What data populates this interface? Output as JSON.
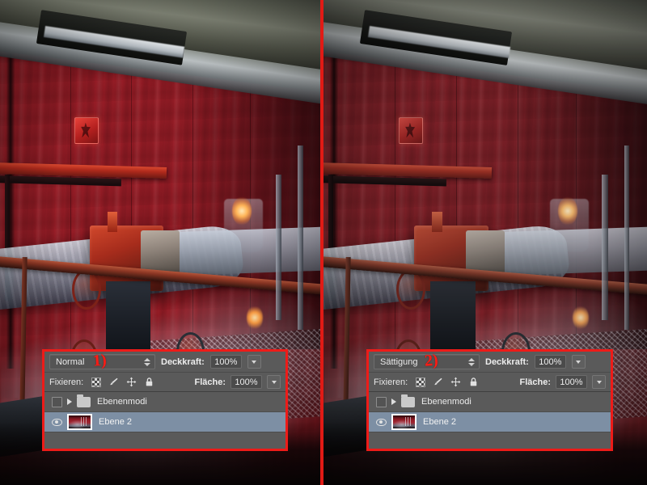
{
  "comparison": {
    "divider_color": "#e11a15",
    "annotation_color": "#ff1b14"
  },
  "panels": [
    {
      "id": "left",
      "callout": "1)",
      "blend_mode_select": {
        "value": "Normal",
        "icon": "updown-arrows-icon"
      },
      "opacity": {
        "label": "Deckkraft:",
        "value": "100%",
        "stepper_icon": "chevron-down-icon"
      },
      "lock": {
        "label": "Fixieren:",
        "icons": [
          "transparent-pixels-checkerboard-icon",
          "paintbrush-icon",
          "move-arrows-icon",
          "lock-all-icon"
        ]
      },
      "fill": {
        "label": "Fläche:",
        "value": "100%",
        "stepper_icon": "chevron-down-icon"
      },
      "layers": [
        {
          "type": "group",
          "name": "Ebenenmodi",
          "visible": false,
          "selected": false,
          "disclosure_icon": "disclosure-triangle-collapsed-icon",
          "folder_icon": "folder-icon",
          "visibility_icon": "eye-off-icon"
        },
        {
          "type": "layer",
          "name": "Ebene 2",
          "visible": true,
          "selected": true,
          "thumbnail_icon": "layer-thumbnail",
          "visibility_icon": "eye-icon"
        }
      ]
    },
    {
      "id": "right",
      "callout": "2)",
      "blend_mode_select": {
        "value": "Sättigung",
        "icon": "updown-arrows-icon"
      },
      "opacity": {
        "label": "Deckkraft:",
        "value": "100%",
        "stepper_icon": "chevron-down-icon"
      },
      "lock": {
        "label": "Fixieren:",
        "icons": [
          "transparent-pixels-checkerboard-icon",
          "paintbrush-icon",
          "move-arrows-icon",
          "lock-all-icon"
        ]
      },
      "fill": {
        "label": "Fläche:",
        "value": "100%",
        "stepper_icon": "chevron-down-icon"
      },
      "layers": [
        {
          "type": "group",
          "name": "Ebenenmodi",
          "visible": false,
          "selected": false,
          "disclosure_icon": "disclosure-triangle-collapsed-icon",
          "folder_icon": "folder-icon",
          "visibility_icon": "eye-off-icon"
        },
        {
          "type": "layer",
          "name": "Ebene 2",
          "visible": true,
          "selected": true,
          "thumbnail_icon": "layer-thumbnail",
          "visibility_icon": "eye-icon"
        }
      ]
    }
  ]
}
